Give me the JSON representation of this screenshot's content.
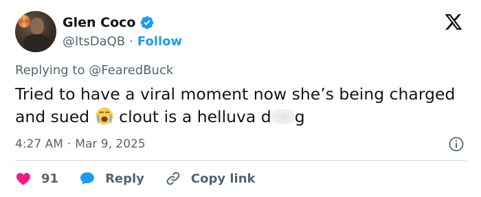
{
  "user": {
    "name": "Glen Coco",
    "handle": "@ItsDaQB",
    "separator": "·",
    "follow_label": "Follow"
  },
  "reply_context": {
    "prefix": "Replying to",
    "target": "@FearedBuck"
  },
  "tweet": {
    "text_part1": "Tried to have a viral moment now she’s being charged and sued",
    "emoji": "loudly-crying-face",
    "text_part2": "clout is a helluva d",
    "text_part3": "g"
  },
  "meta": {
    "time": "4:27 AM",
    "separator": "·",
    "date": "Mar 9, 2025"
  },
  "actions": {
    "like_count": "91",
    "reply_label": "Reply",
    "copy_label": "Copy link"
  },
  "colors": {
    "like": "#f91880",
    "reply": "#1d9bf0",
    "verified": "#1d9bf0",
    "secondary_text": "#536471"
  },
  "icons": [
    "verified-badge-icon",
    "x-logo-icon",
    "info-icon",
    "heart-icon",
    "reply-bubble-icon",
    "link-icon"
  ]
}
